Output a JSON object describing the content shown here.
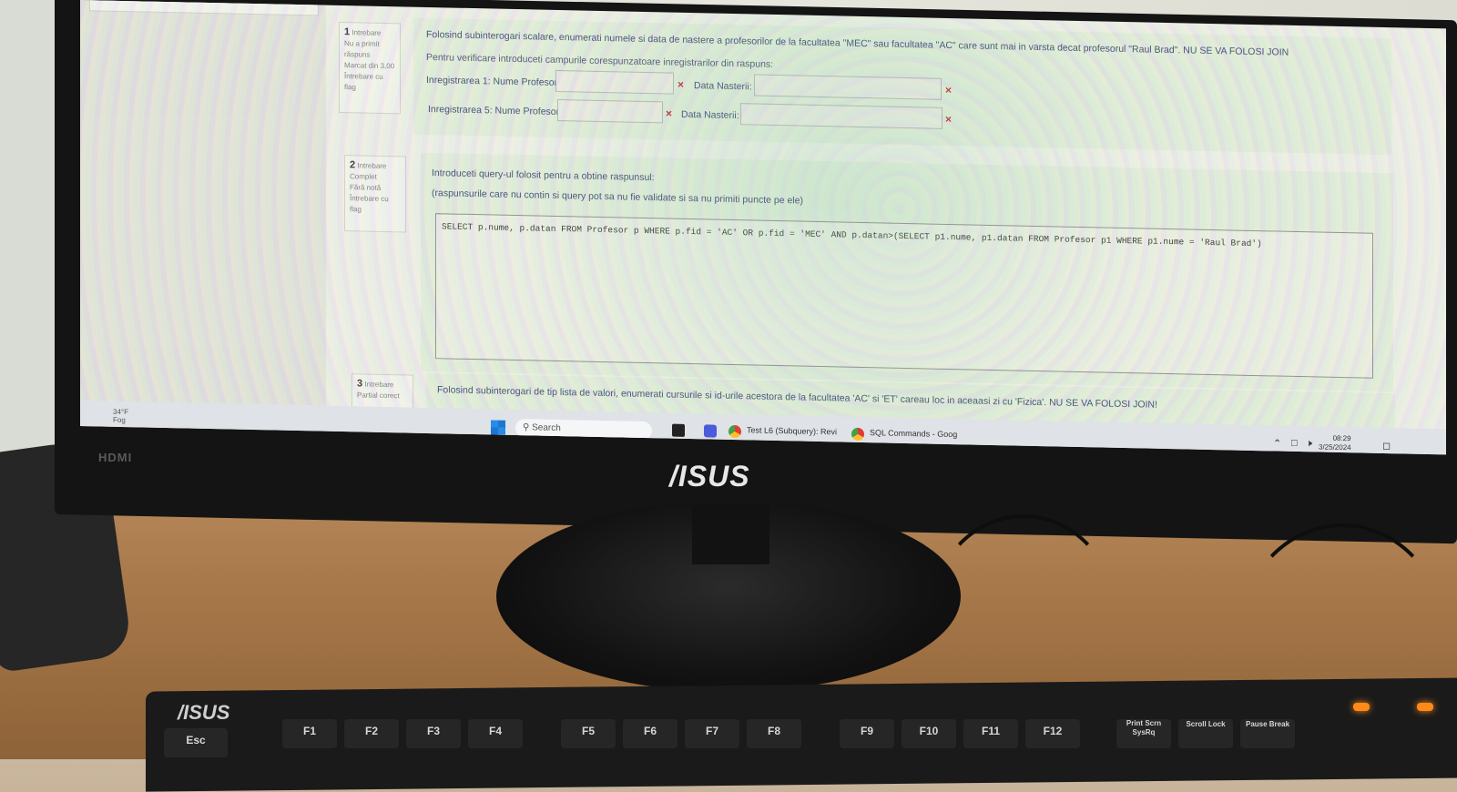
{
  "quiz": {
    "q1": {
      "number": "1",
      "label": "Intrebare",
      "status": "Nu a primit răspuns",
      "marks": "Marcat din 3,00",
      "flag": "Întrebare cu flag",
      "text": "Folosind subinterogari scalare, enumerati numele si data de nastere a profesorilor de la facultatea \"MEC\" sau facultatea \"AC\" care sunt mai in varsta decat profesorul \"Raul Brad\". NU SE VA FOLOSI JOIN",
      "instructions": "Pentru verificare introduceti campurile corespunzatoare inregistrarilor din raspuns:",
      "row1_name_label": "Inregistrarea 1: Nume Profesor:",
      "row1_date_label": "Data Nasterii:",
      "row5_name_label": "Inregistrarea 5: Nume Profesor:",
      "row5_date_label": "Data Nasterii:",
      "wrong_mark": "×"
    },
    "q2": {
      "number": "2",
      "label": "Intrebare",
      "status": "Complet",
      "marks": "Fără notă",
      "flag": "Întrebare cu flag",
      "text": "Introduceti query-ul folosit pentru a obtine raspunsul:",
      "note": "(raspunsurile care nu contin si query pot sa nu fie validate si sa nu primiti puncte pe ele)",
      "query": "SELECT  p.nume, p.datan FROM Profesor p WHERE p.fid = 'AC' OR p.fid = 'MEC' AND p.datan>(SELECT p1.nume, p1.datan FROM Profesor p1 WHERE p1.nume = 'Raul Brad')"
    },
    "q3": {
      "number": "3",
      "label": "Intrebare",
      "status": "Partial corect",
      "text": "Folosind subinterogari de tip lista de valori, enumerati cursurile si id-urile acestora de la facultatea 'AC' si 'ET' careau loc in aceaasi zi cu 'Fizica'. NU SE VA FOLOSI JOIN!"
    }
  },
  "taskbar": {
    "weather_temp": "34°F",
    "weather_desc": "Fog",
    "search": "Search",
    "app1": "Test L6 (Subquery): Revi",
    "app2": "SQL Commands - Goog",
    "time": "08:29",
    "date": "3/25/2024"
  },
  "monitor": {
    "hdmi_label": "HDMI",
    "brand": "/ISUS"
  },
  "keyboard": {
    "brand": "/ISUS",
    "keys": [
      "Esc",
      "F1",
      "F2",
      "F3",
      "F4",
      "F5",
      "F6",
      "F7",
      "F8",
      "F9",
      "F10",
      "F11",
      "F12",
      "Print Scrn SysRq",
      "Scroll Lock",
      "Pause Break"
    ]
  }
}
